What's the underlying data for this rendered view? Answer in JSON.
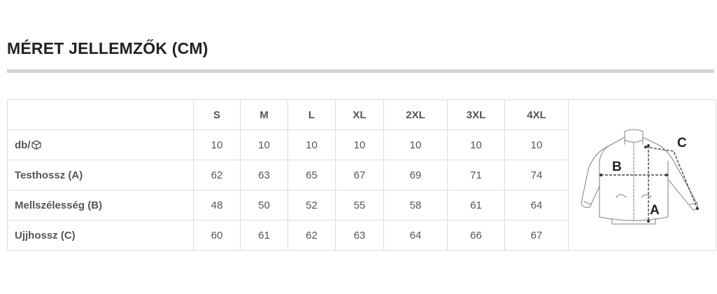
{
  "title": "MÉRET JELLEMZŐK (CM)",
  "table": {
    "columns": [
      "S",
      "M",
      "L",
      "XL",
      "2XL",
      "3XL",
      "4XL"
    ],
    "rows": [
      {
        "label": "db/",
        "icon": "box-icon",
        "values": [
          "10",
          "10",
          "10",
          "10",
          "10",
          "10",
          "10"
        ]
      },
      {
        "label": "Testhossz (A)",
        "values": [
          "62",
          "63",
          "65",
          "67",
          "69",
          "71",
          "74"
        ]
      },
      {
        "label": "Mellszélesség (B)",
        "values": [
          "48",
          "50",
          "52",
          "55",
          "58",
          "61",
          "64"
        ]
      },
      {
        "label": "Ujjhossz (C)",
        "values": [
          "60",
          "61",
          "62",
          "63",
          "64",
          "66",
          "67"
        ]
      }
    ]
  },
  "diagram": {
    "labels": {
      "a": "A",
      "b": "B",
      "c": "C"
    }
  }
}
